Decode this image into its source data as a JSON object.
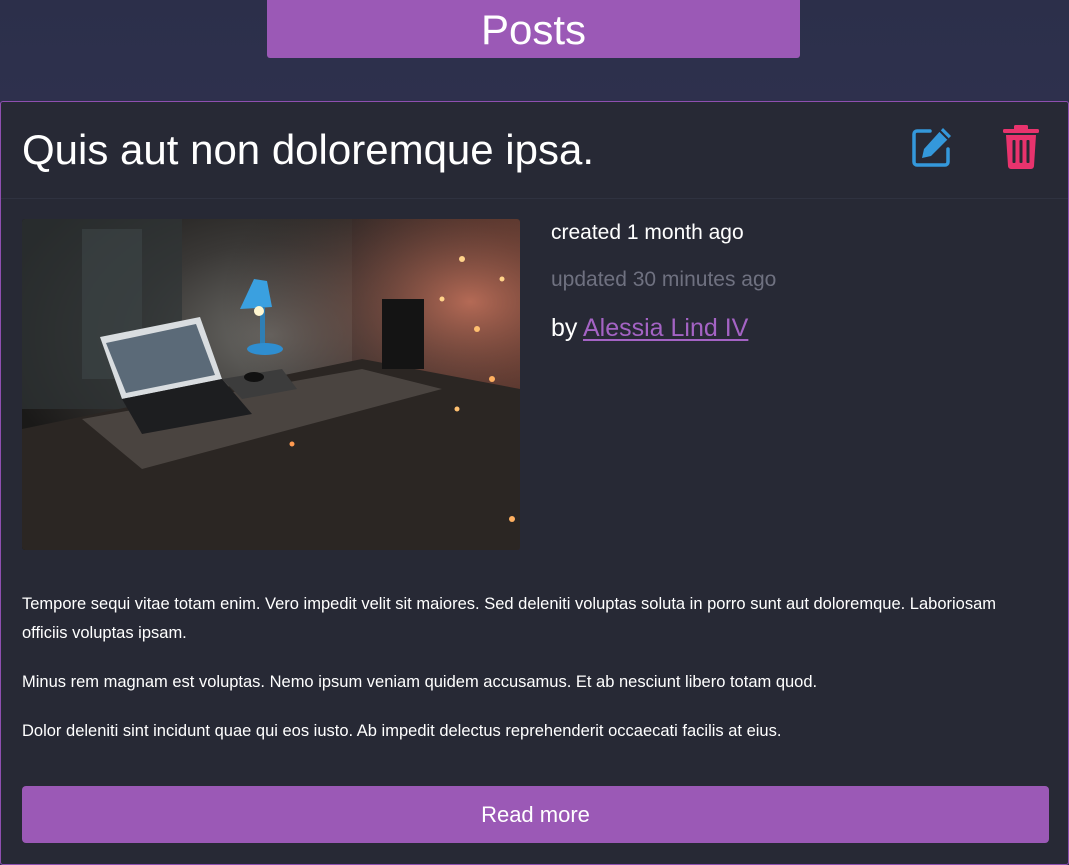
{
  "header": {
    "title": "Posts"
  },
  "post": {
    "title": "Quis aut non doloremque ipsa.",
    "created": "created 1 month ago",
    "updated": "updated 30 minutes ago",
    "by_prefix": "by ",
    "author": "Alessia Lind IV",
    "paragraphs": [
      "Tempore sequi vitae totam enim. Vero impedit velit sit maiores. Sed deleniti voluptas soluta in porro sunt aut doloremque. Laboriosam officiis voluptas ipsam.",
      "Minus rem magnam est voluptas. Nemo ipsum veniam quidem accusamus. Et ab nesciunt libero totam quod.",
      "Dolor deleniti sint incidunt quae qui eos iusto. Ab impedit delectus reprehenderit occaecati facilis at eius."
    ],
    "read_more_label": "Read more",
    "actions": {
      "edit_icon": "edit-icon",
      "delete_icon": "trash-icon"
    }
  },
  "colors": {
    "accent": "#9b59b6",
    "edit": "#3498db",
    "delete": "#e8336d",
    "card_bg": "#272935",
    "muted_text": "#6f7180"
  }
}
